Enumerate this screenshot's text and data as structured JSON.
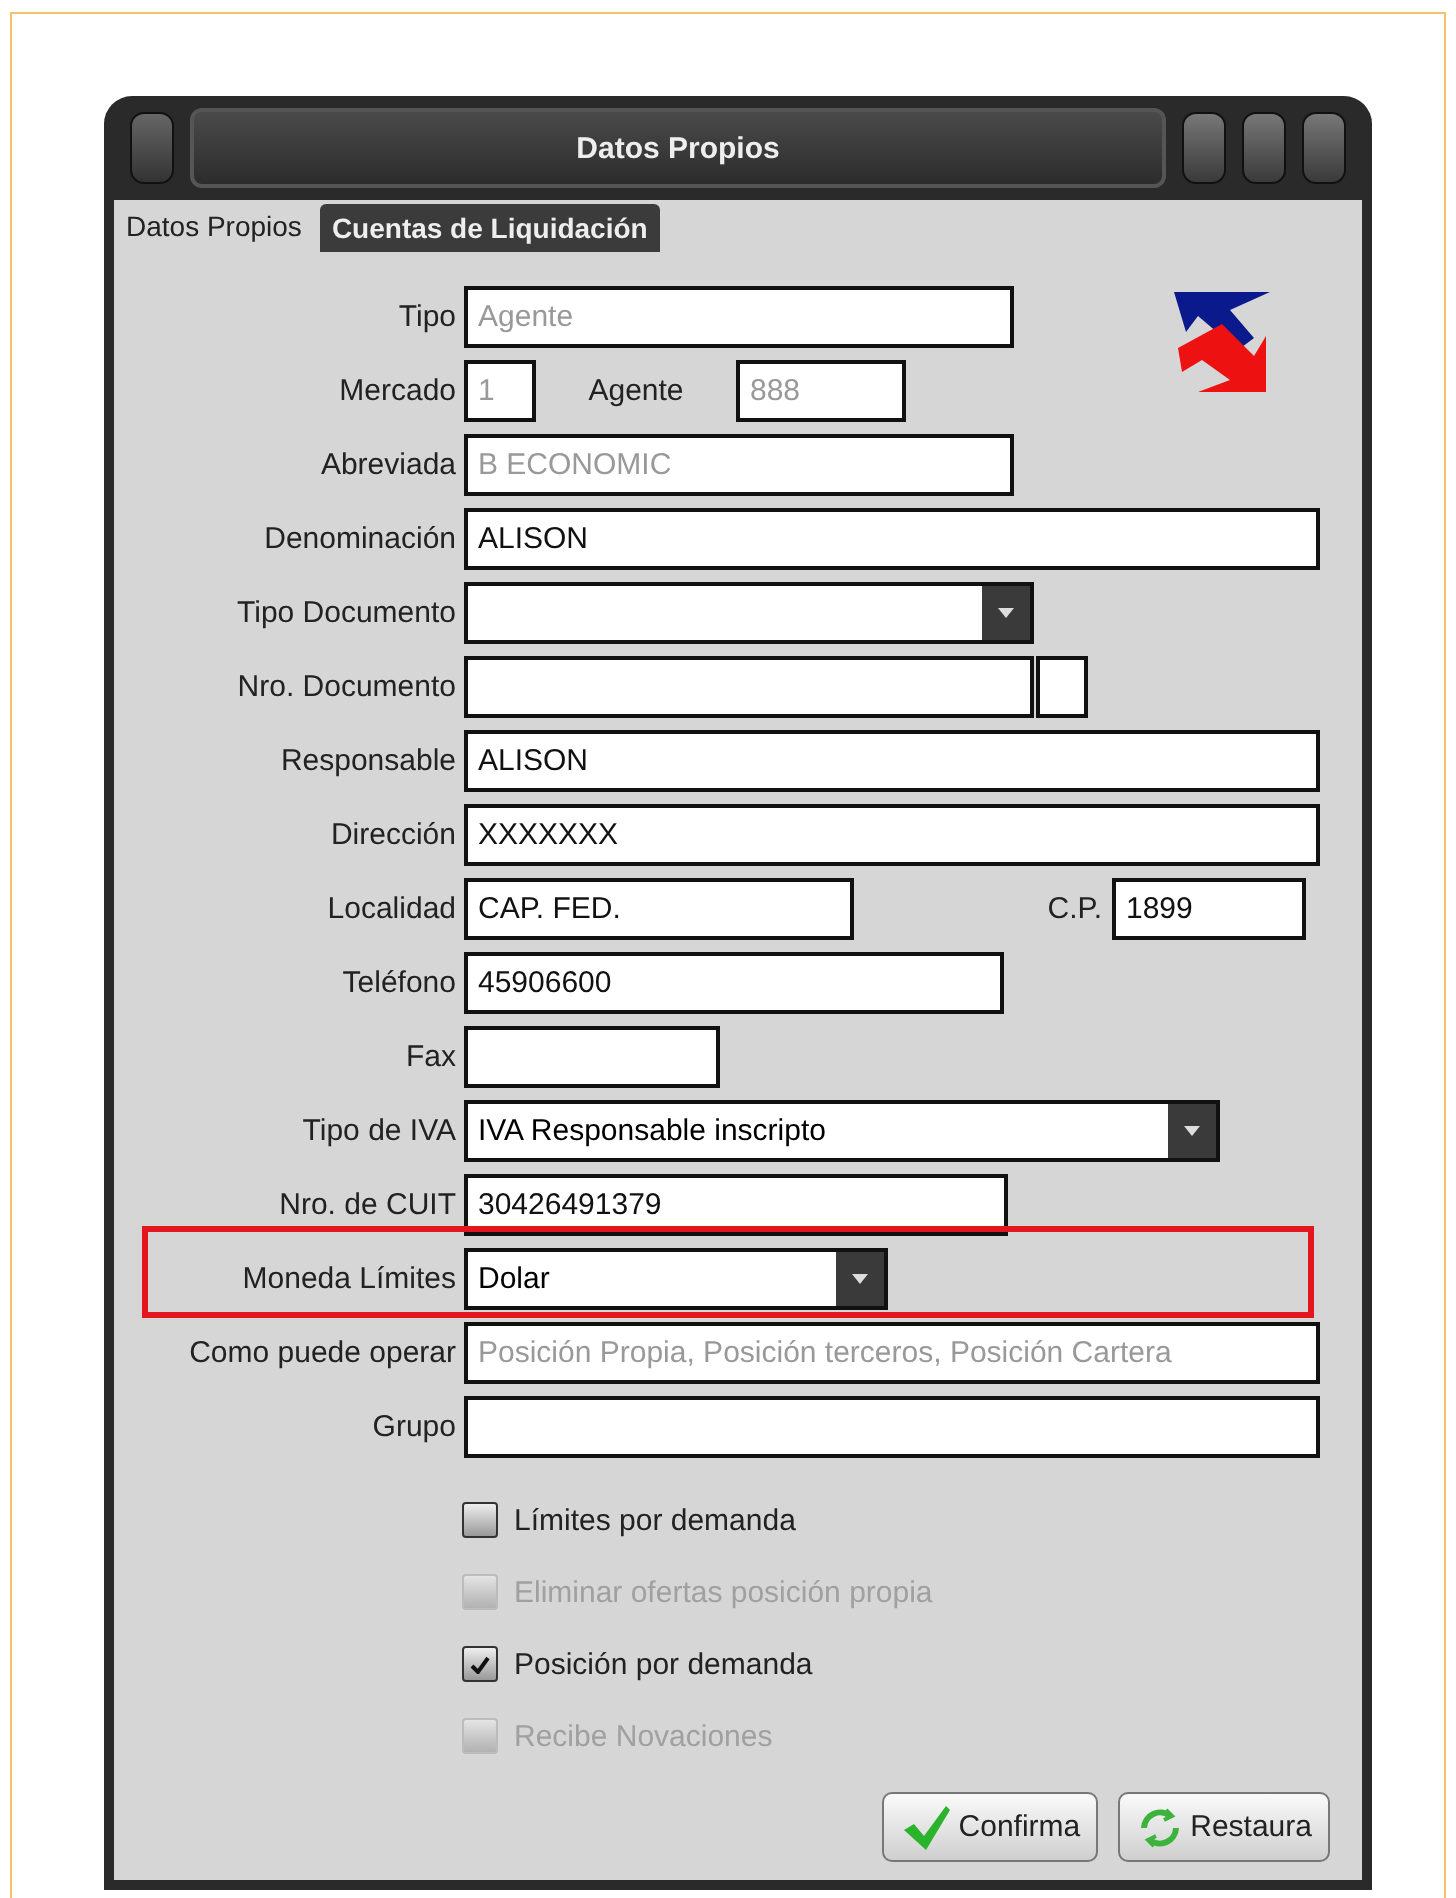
{
  "window": {
    "title": "Datos Propios"
  },
  "tabs": [
    {
      "label": "Datos Propios",
      "selected": true
    },
    {
      "label": "Cuentas de Liquidación",
      "selected": false
    }
  ],
  "rows": [
    {
      "kind": "text",
      "label": "Tipo",
      "value": "Agente",
      "disabled": true
    },
    {
      "kind": "pair",
      "label": "Mercado",
      "value": "1",
      "disabled": true,
      "second_label": "Agente",
      "second_value": "888",
      "second_disabled": true
    },
    {
      "kind": "text",
      "label": "Abreviada",
      "value": "B ECONOMIC",
      "disabled": true
    },
    {
      "kind": "text",
      "label": "Denominación",
      "value": "ALISON",
      "disabled": false
    },
    {
      "kind": "combo",
      "label": "Tipo Documento"
    },
    {
      "kind": "doc",
      "label": "Nro. Documento"
    },
    {
      "kind": "text",
      "label": "Responsable",
      "value": "ALISON",
      "disabled": false
    },
    {
      "kind": "text",
      "label": "Dirección",
      "value": "XXXXXXX",
      "disabled": false
    },
    {
      "kind": "pair",
      "label": "Localidad",
      "value": "CAP. FED.",
      "disabled": false,
      "second_label": "C.P.",
      "second_value": "1899",
      "second_disabled": false
    },
    {
      "kind": "text",
      "label": "Teléfono",
      "value": "45906600",
      "disabled": false
    },
    {
      "kind": "text",
      "label": "Fax"
    },
    {
      "kind": "combo",
      "label": "Tipo de IVA",
      "value": "IVA Responsable inscripto"
    },
    {
      "kind": "text",
      "label": "Nro. de CUIT",
      "value": "30426491379",
      "disabled": false
    },
    {
      "kind": "combo",
      "label": "Moneda Límites",
      "value": "Dolar",
      "highlighted": true
    },
    {
      "kind": "text",
      "label": "Como puede operar",
      "value": "Posición Propia, Posición terceros, Posición Cartera",
      "disabled": true
    },
    {
      "kind": "text",
      "label": "Grupo"
    }
  ],
  "checkboxes": [
    {
      "label": "Límites por demanda",
      "checked": false,
      "disabled": false
    },
    {
      "label": "Eliminar ofertas posición propia",
      "checked": false,
      "disabled": true
    },
    {
      "label": "Posición por demanda",
      "checked": true,
      "disabled": false
    },
    {
      "label": "Recibe Novaciones",
      "checked": false,
      "disabled": true
    }
  ],
  "buttons": [
    {
      "label": "Confirma",
      "kind": "confirm"
    },
    {
      "label": "Restaura",
      "kind": "restore"
    }
  ]
}
